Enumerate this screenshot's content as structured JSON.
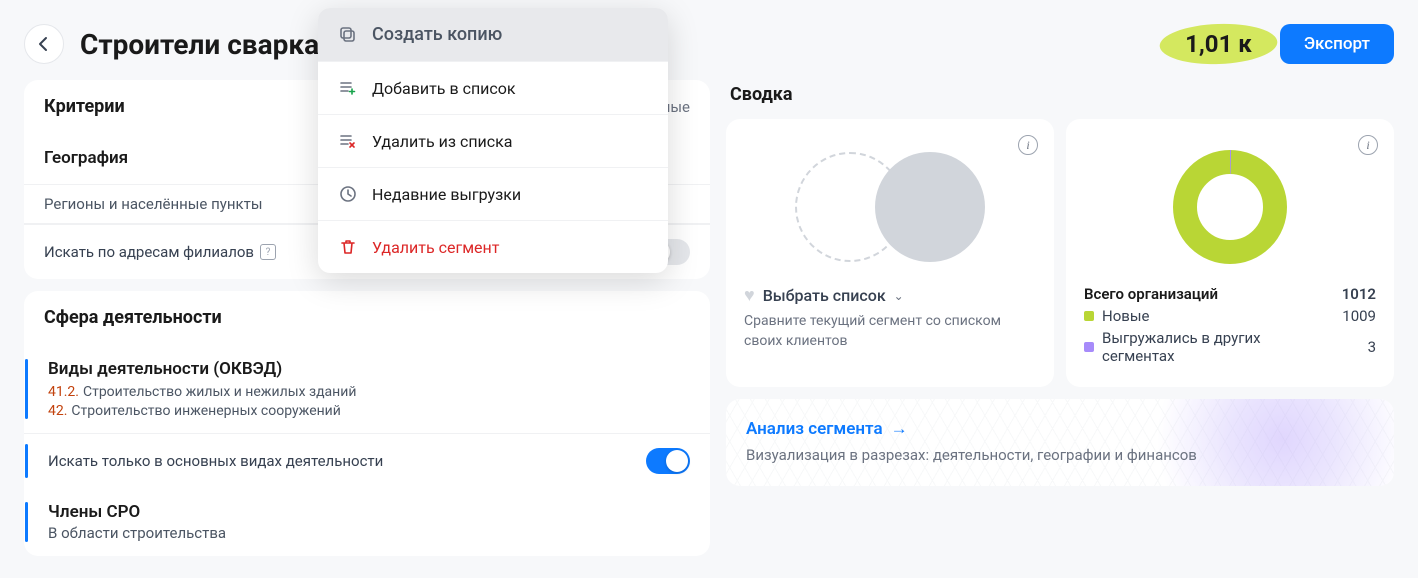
{
  "header": {
    "title": "Строители сварка",
    "count": "1,01 к",
    "export": "Экспорт"
  },
  "criteria": {
    "title": "Критерии",
    "changed": "менённые",
    "geography": {
      "title": "География",
      "subtitle": "Регионы и населённые пункты",
      "branch_search": "Искать по адресам филиалов"
    },
    "sphere": {
      "title": "Сфера деятельности",
      "okved_title": "Виды деятельности (ОКВЭД)",
      "okved": [
        {
          "code": "41.2.",
          "text": "Строительство жилых и нежилых зданий"
        },
        {
          "code": "42.",
          "text": "Строительство инженерных сооружений"
        }
      ],
      "main_only": "Искать только в основных видах деятельности",
      "sro_title": "Члены СРО",
      "sro_sub": "В области строительства"
    }
  },
  "menu": {
    "copy": "Создать копию",
    "add": "Добавить в список",
    "remove": "Удалить из списка",
    "recent": "Недавние выгрузки",
    "delete": "Удалить сегмент"
  },
  "summary": {
    "title": "Сводка",
    "select_list": "Выбрать список",
    "compare": "Сравните текущий сегмент со списком своих клиентов",
    "total_label": "Всего организаций",
    "total_val": "1012",
    "new_label": "Новые",
    "new_val": "1009",
    "exported_label": "Выгружались в других сегментах",
    "exported_val": "3"
  },
  "analysis": {
    "title": "Анализ сегмента",
    "sub": "Визуализация в разрезах: деятельности, географии и финансов"
  },
  "colors": {
    "new": "#b9d635",
    "exported": "#a78bfa"
  },
  "chart_data": {
    "type": "pie",
    "title": "Всего организаций",
    "series": [
      {
        "name": "Новые",
        "value": 1009,
        "color": "#b9d635"
      },
      {
        "name": "Выгружались в других сегментах",
        "value": 3,
        "color": "#a78bfa"
      }
    ],
    "total": 1012
  }
}
